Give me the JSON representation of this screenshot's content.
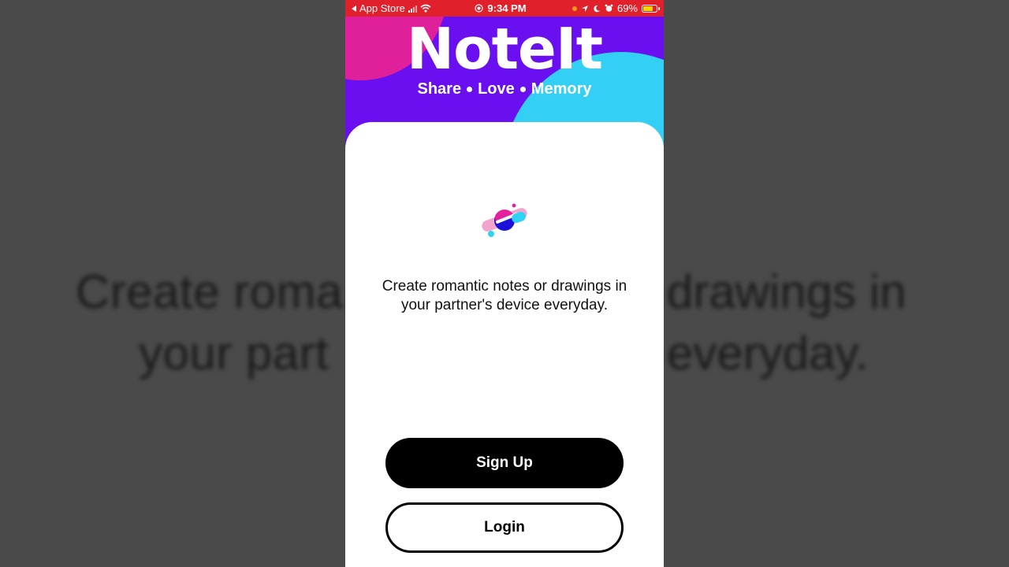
{
  "background": {
    "line1_left": "Create roma",
    "line2_left": "your part",
    "line1_right": "drawings in",
    "line2_right": "everyday."
  },
  "status_bar": {
    "back_label": "App Store",
    "time": "9:34 PM",
    "battery": "69%"
  },
  "header": {
    "title": "NoteIt",
    "tagline": [
      "Share",
      "Love",
      "Memory"
    ]
  },
  "main": {
    "description_line1": "Create romantic notes or drawings in",
    "description_line2": "your partner's device everyday."
  },
  "buttons": {
    "signup": "Sign Up",
    "login": "Login"
  },
  "colors": {
    "status_bar": "#e0202a",
    "header_purple": "#6a10f0",
    "pink": "#e0209a",
    "cyan": "#34cff5",
    "primary_button": "#000000"
  }
}
